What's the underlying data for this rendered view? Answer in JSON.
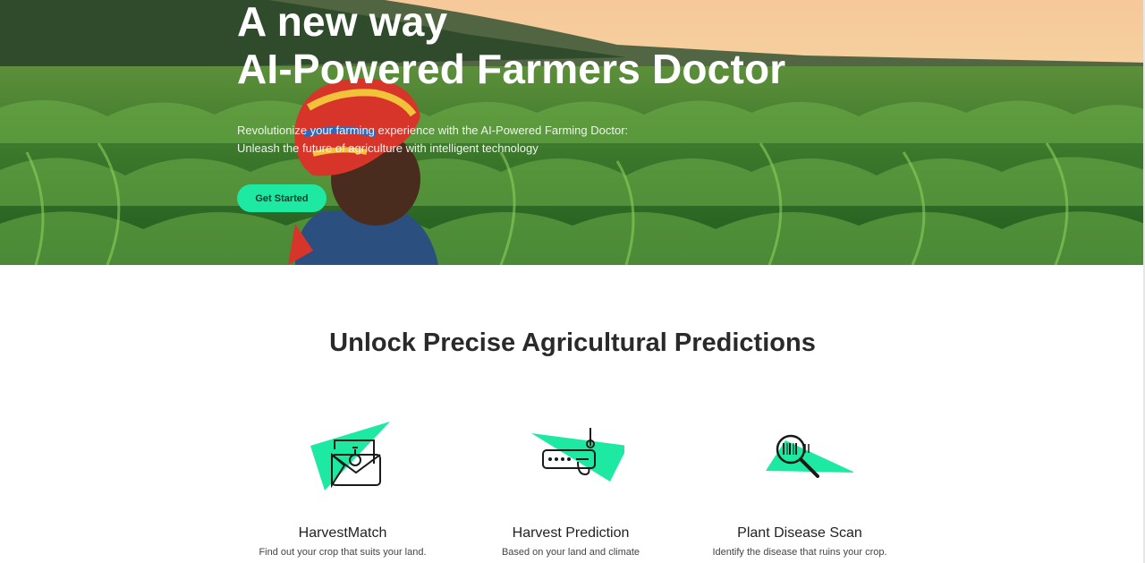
{
  "hero": {
    "title_line1": "A new way",
    "title_line2": "AI-Powered Farmers Doctor",
    "subtitle_line1": "Revolutionize your farming experience with the AI-Powered Farming Doctor:",
    "subtitle_line2": "Unleash the future of agriculture with intelligent technology",
    "cta_label": "Get Started"
  },
  "predictions": {
    "heading": "Unlock Precise Agricultural Predictions",
    "features": [
      {
        "icon": "harvest-match-icon",
        "title": "HarvestMatch",
        "description": "Find out your crop that suits your land."
      },
      {
        "icon": "harvest-prediction-icon",
        "title": "Harvest Prediction",
        "description": "Based on your land and climate"
      },
      {
        "icon": "plant-disease-scan-icon",
        "title": "Plant Disease Scan",
        "description": "Identify the disease that ruins your crop."
      }
    ]
  },
  "colors": {
    "accent": "#1de9a3",
    "heading": "#2a2a2a",
    "hero_text": "#ffffff"
  }
}
